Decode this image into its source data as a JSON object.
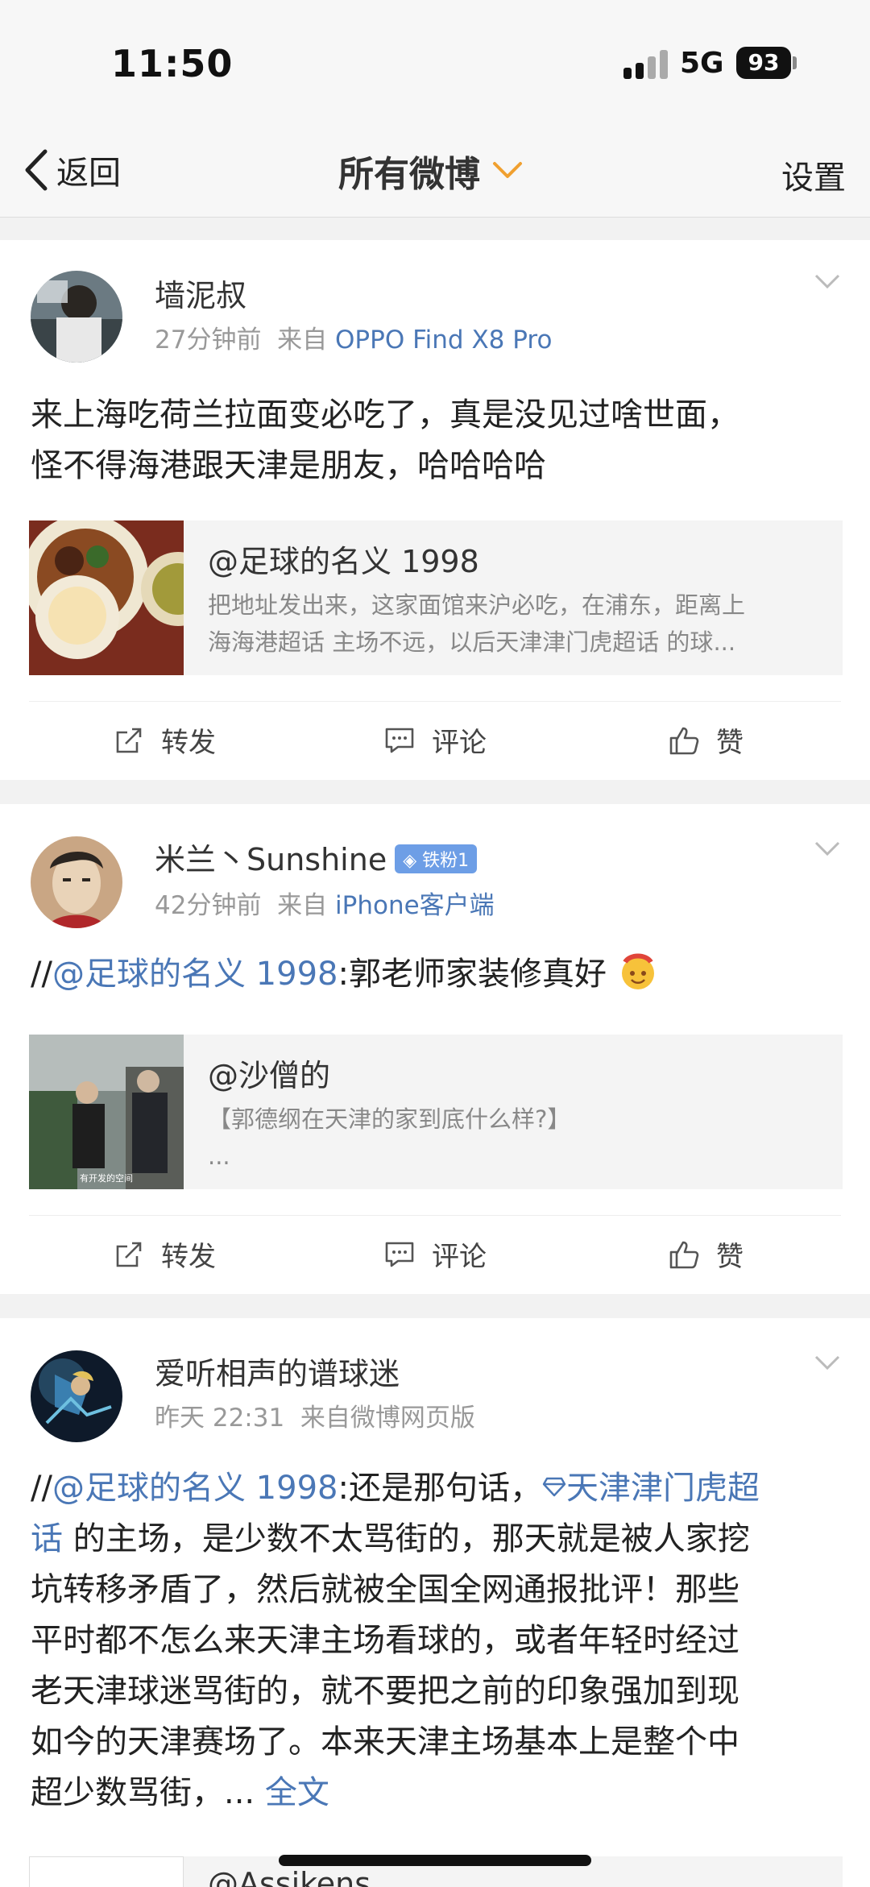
{
  "status": {
    "time": "11:50",
    "network": "5G",
    "battery": "93"
  },
  "nav": {
    "back": "返回",
    "title": "所有微博",
    "settings": "设置"
  },
  "actions": {
    "repost": "转发",
    "comment": "评论",
    "like": "赞"
  },
  "posts": [
    {
      "username": "墙泥叔",
      "time": "27分钟前",
      "from_prefix": "来自",
      "source": "OPPO Find X8 Pro",
      "text_line1": "来上海吃荷兰拉面变必吃了，真是没见过啥世面，",
      "text_line2": "怪不得海港跟天津是朋友，哈哈哈哈",
      "quote": {
        "author": "@足球的名义 1998",
        "text_line1": "把地址发出来，这家面馆来沪必吃，在浦东，距离上",
        "text_line2": "海海港超话 主场不远，以后天津津门虎超话 的球..."
      }
    },
    {
      "username": "米兰丶Sunshine",
      "badge": "铁粉1",
      "time": "42分钟前",
      "from_prefix": "来自",
      "source": "iPhone客户端",
      "prefix": "//",
      "mention": "@足球的名义 1998",
      "text": ":郭老师家装修真好",
      "quote": {
        "author": "@沙僧的",
        "text_line1": "【郭德纲在天津的家到底什么样?】",
        "text_line2": "...",
        "thumb_caption": "有开发的空间"
      }
    },
    {
      "username": "爱听相声的谱球迷",
      "time": "昨天 22:31",
      "from_prefix": "来自",
      "source": "微博网页版",
      "prefix": "//",
      "mention": "@足球的名义 1998",
      "text_a": ":还是那句话，",
      "topic_a": "天津津门虎超",
      "topic_b": "话",
      "text_b": " 的主场，是少数不太骂街的，那天就是被人家挖",
      "line3": "坑转移矛盾了，然后就被全国全网通报批评！那些",
      "line4": "平时都不怎么来天津主场看球的，或者年轻时经过",
      "line5": "老天津球迷骂街的，就不要把之前的印象强加到现",
      "line6": "如今的天津赛场了。本来天津主场基本上是整个中",
      "line7": "超少数骂街，... ",
      "full_text": "全文",
      "quote": {
        "author": "@Assikens"
      }
    }
  ]
}
